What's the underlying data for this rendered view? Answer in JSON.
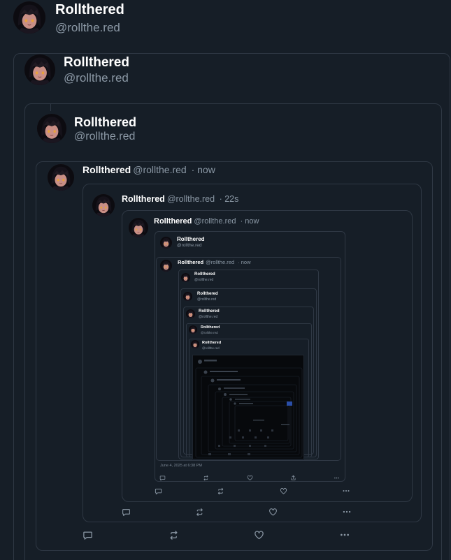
{
  "user": {
    "name": "Rollthered",
    "handle": "@rollthe.red"
  },
  "posts": {
    "p1": {
      "name": "Rollthered",
      "handle": "@rollthe.red"
    },
    "p2": {
      "name": "Rollthered",
      "handle": "@rollthe.red"
    },
    "p3": {
      "name": "Rollthered",
      "handle": "@rollthe.red"
    },
    "p4": {
      "name": "Rollthered",
      "handle": "@rollthe.red",
      "time": "· now"
    },
    "p5": {
      "name": "Rollthered",
      "handle": "@rollthe.red",
      "time": "· 22s"
    },
    "p6": {
      "name": "Rollthered",
      "handle": "@rollthe.red",
      "time": "· now"
    },
    "p7": {
      "name": "Rollthered",
      "handle": "@rollthe.red"
    },
    "p8": {
      "name": "Rollthered",
      "handle": "@rollthe.red",
      "time": "· now"
    },
    "p9": {
      "name": "Rollthered",
      "handle": "@rollthe.red"
    },
    "p10": {
      "name": "Rollthered",
      "handle": "@rollthe.red"
    },
    "p11": {
      "name": "Rollthered",
      "handle": "@rollthe.red"
    },
    "p12": {
      "name": "Rollthered",
      "handle": "@rollthe.red"
    },
    "p13": {
      "name": "Rollthered",
      "handle": "@rollthe.red"
    }
  },
  "timestamp": "June 4, 2025 at 6:38 PM",
  "icons": {
    "reply": "reply-icon",
    "repost": "repost-icon",
    "like": "like-icon",
    "more": "more-icon",
    "share": "share-icon"
  },
  "colors": {
    "background": "#161e27",
    "border": "#2f3844",
    "muted": "#8b98a5"
  }
}
